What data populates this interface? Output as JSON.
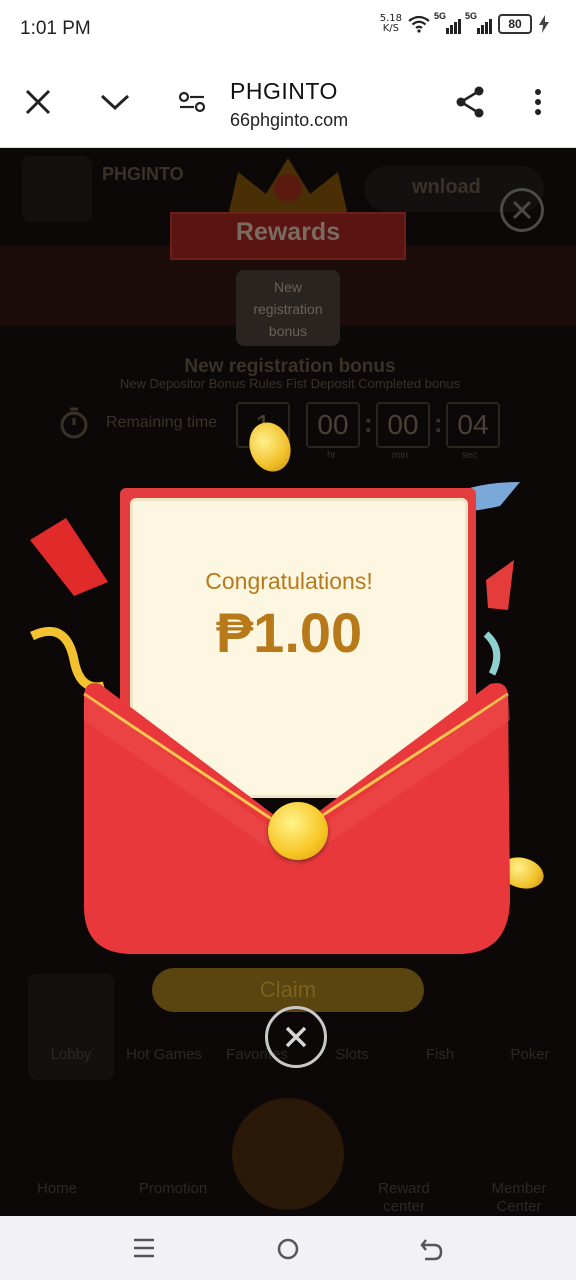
{
  "status_bar": {
    "time": "1:01 PM",
    "net_speed_value": "5.18",
    "net_speed_unit": "K/S",
    "sim1": "5G",
    "sim2": "5G",
    "battery": "80"
  },
  "browser": {
    "title": "PHGINTO",
    "url": "66phginto.com"
  },
  "background": {
    "app_name": "PHGINTO",
    "download_label": "wnload",
    "new_registration_tab": "New registration bonus",
    "bonus_heading": "New registration bonus",
    "bonus_subtext": "New Depositor Bonus Rules Fist Deposit Completed bonus",
    "remaining_label": "Remaining time",
    "timer": {
      "days": "1",
      "hours": "00",
      "minutes": "00",
      "seconds": "04",
      "hr_label": "hr",
      "min_label": "min",
      "sec_label": "sec"
    },
    "nav_items": [
      "Home",
      "Promotion",
      "Reward center",
      "Member Center"
    ],
    "category_items": [
      "Lobby",
      "Hot Games",
      "Favorites",
      "Slots",
      "Fish",
      "Poker"
    ]
  },
  "modal": {
    "rewards_title": "Rewards",
    "congrats": "Congratulations!",
    "amount": "₱1.00",
    "claim_label": "Claim"
  },
  "colors": {
    "envelope_red": "#e8383b",
    "gold_text": "#b8791a"
  }
}
